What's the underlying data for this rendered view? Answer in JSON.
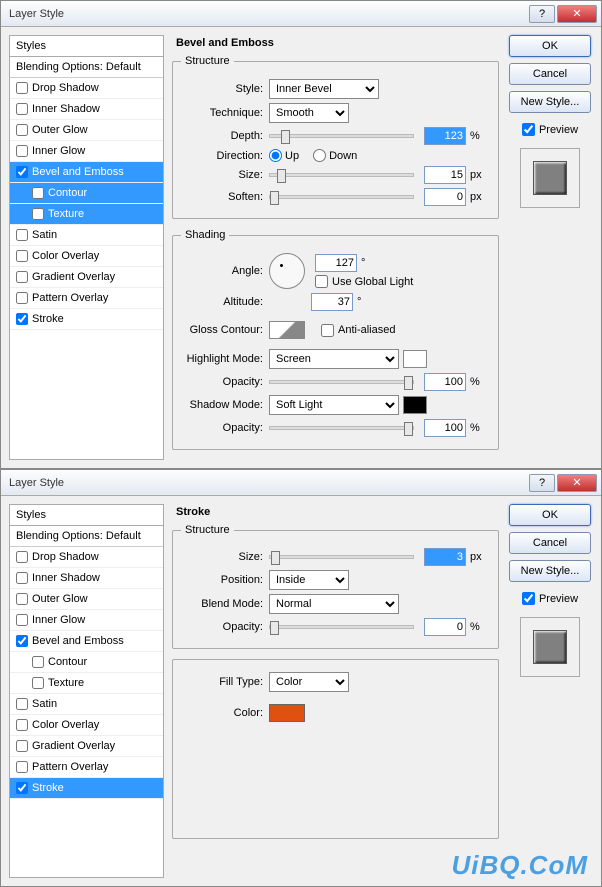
{
  "dialog1": {
    "title": "Layer Style",
    "stylesHeader": "Styles",
    "blendingDefault": "Blending Options: Default",
    "styles": [
      {
        "label": "Drop Shadow",
        "checked": false,
        "selected": false,
        "indent": false
      },
      {
        "label": "Inner Shadow",
        "checked": false,
        "selected": false,
        "indent": false
      },
      {
        "label": "Outer Glow",
        "checked": false,
        "selected": false,
        "indent": false
      },
      {
        "label": "Inner Glow",
        "checked": false,
        "selected": false,
        "indent": false
      },
      {
        "label": "Bevel and Emboss",
        "checked": true,
        "selected": true,
        "indent": false
      },
      {
        "label": "Contour",
        "checked": false,
        "selected": true,
        "indent": true
      },
      {
        "label": "Texture",
        "checked": false,
        "selected": true,
        "indent": true
      },
      {
        "label": "Satin",
        "checked": false,
        "selected": false,
        "indent": false
      },
      {
        "label": "Color Overlay",
        "checked": false,
        "selected": false,
        "indent": false
      },
      {
        "label": "Gradient Overlay",
        "checked": false,
        "selected": false,
        "indent": false
      },
      {
        "label": "Pattern Overlay",
        "checked": false,
        "selected": false,
        "indent": false
      },
      {
        "label": "Stroke",
        "checked": true,
        "selected": false,
        "indent": false
      }
    ],
    "panelTitle": "Bevel and Emboss",
    "structure": {
      "legend": "Structure",
      "styleLabel": "Style:",
      "styleValue": "Inner Bevel",
      "techniqueLabel": "Technique:",
      "techniqueValue": "Smooth",
      "depthLabel": "Depth:",
      "depthValue": "123",
      "depthUnit": "%",
      "directionLabel": "Direction:",
      "upLabel": "Up",
      "downLabel": "Down",
      "sizeLabel": "Size:",
      "sizeValue": "15",
      "sizeUnit": "px",
      "softenLabel": "Soften:",
      "softenValue": "0",
      "softenUnit": "px"
    },
    "shading": {
      "legend": "Shading",
      "angleLabel": "Angle:",
      "angleValue": "127",
      "angleUnit": "°",
      "globalLightLabel": "Use Global Light",
      "altitudeLabel": "Altitude:",
      "altitudeValue": "37",
      "altitudeUnit": "°",
      "glossLabel": "Gloss Contour:",
      "antiAliasedLabel": "Anti-aliased",
      "highlightLabel": "Highlight Mode:",
      "highlightValue": "Screen",
      "opacityLabel": "Opacity:",
      "highlightOpacity": "100",
      "highlightOpacityUnit": "%",
      "shadowLabel": "Shadow Mode:",
      "shadowValue": "Soft Light",
      "shadowOpacity": "100",
      "shadowOpacityUnit": "%"
    },
    "buttons": {
      "ok": "OK",
      "cancel": "Cancel",
      "newStyle": "New Style...",
      "preview": "Preview"
    }
  },
  "dialog2": {
    "title": "Layer Style",
    "stylesHeader": "Styles",
    "blendingDefault": "Blending Options: Default",
    "styles": [
      {
        "label": "Drop Shadow",
        "checked": false,
        "selected": false,
        "indent": false
      },
      {
        "label": "Inner Shadow",
        "checked": false,
        "selected": false,
        "indent": false
      },
      {
        "label": "Outer Glow",
        "checked": false,
        "selected": false,
        "indent": false
      },
      {
        "label": "Inner Glow",
        "checked": false,
        "selected": false,
        "indent": false
      },
      {
        "label": "Bevel and Emboss",
        "checked": true,
        "selected": false,
        "indent": false
      },
      {
        "label": "Contour",
        "checked": false,
        "selected": false,
        "indent": true
      },
      {
        "label": "Texture",
        "checked": false,
        "selected": false,
        "indent": true
      },
      {
        "label": "Satin",
        "checked": false,
        "selected": false,
        "indent": false
      },
      {
        "label": "Color Overlay",
        "checked": false,
        "selected": false,
        "indent": false
      },
      {
        "label": "Gradient Overlay",
        "checked": false,
        "selected": false,
        "indent": false
      },
      {
        "label": "Pattern Overlay",
        "checked": false,
        "selected": false,
        "indent": false
      },
      {
        "label": "Stroke",
        "checked": true,
        "selected": true,
        "indent": false
      }
    ],
    "panelTitle": "Stroke",
    "structure": {
      "legend": "Structure",
      "sizeLabel": "Size:",
      "sizeValue": "3",
      "sizeUnit": "px",
      "positionLabel": "Position:",
      "positionValue": "Inside",
      "blendLabel": "Blend Mode:",
      "blendValue": "Normal",
      "opacityLabel": "Opacity:",
      "opacityValue": "0",
      "opacityUnit": "%"
    },
    "fill": {
      "legend": "",
      "fillTypeLabel": "Fill Type:",
      "fillTypeValue": "Color",
      "colorLabel": "Color:",
      "colorValue": "#e05010"
    },
    "buttons": {
      "ok": "OK",
      "cancel": "Cancel",
      "newStyle": "New Style...",
      "preview": "Preview"
    }
  },
  "watermark": "UiBQ.CoM"
}
